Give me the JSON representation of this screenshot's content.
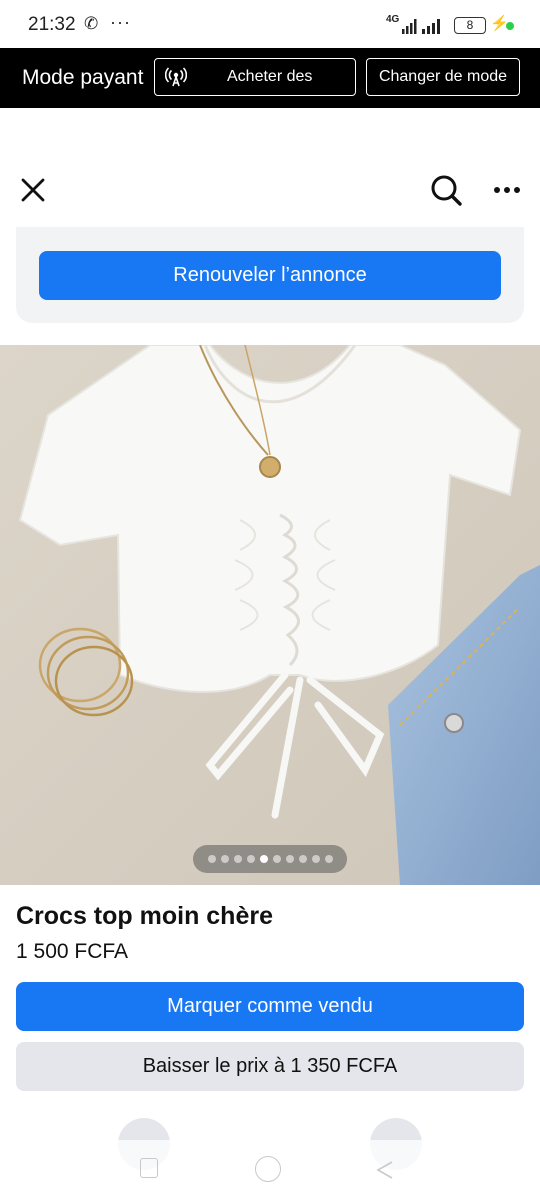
{
  "status_bar": {
    "time": "21:32",
    "phone_icon": "phone-icon",
    "more_dots": "···",
    "network": "4G",
    "battery": "8"
  },
  "mode_bar": {
    "label": "Mode payant",
    "buy_label": "Acheter des",
    "change_label": "Changer de mode"
  },
  "nav": {
    "close_icon": "close-icon",
    "search_icon": "search-icon",
    "more_icon": "more-horizontal-icon"
  },
  "renew": {
    "button_label": "Renouveler l’annonce"
  },
  "photo": {
    "pager": {
      "count": 10,
      "active_index": 4
    }
  },
  "listing": {
    "title": "Crocs top moin chère",
    "price": "1 500 FCFA"
  },
  "actions": {
    "mark_sold": "Marquer comme vendu",
    "lower_price": "Baisser le prix à 1 350 FCFA"
  },
  "colors": {
    "accent": "#1877f2",
    "secondary_button": "#e4e6eb",
    "mode_bar": "#000000"
  }
}
